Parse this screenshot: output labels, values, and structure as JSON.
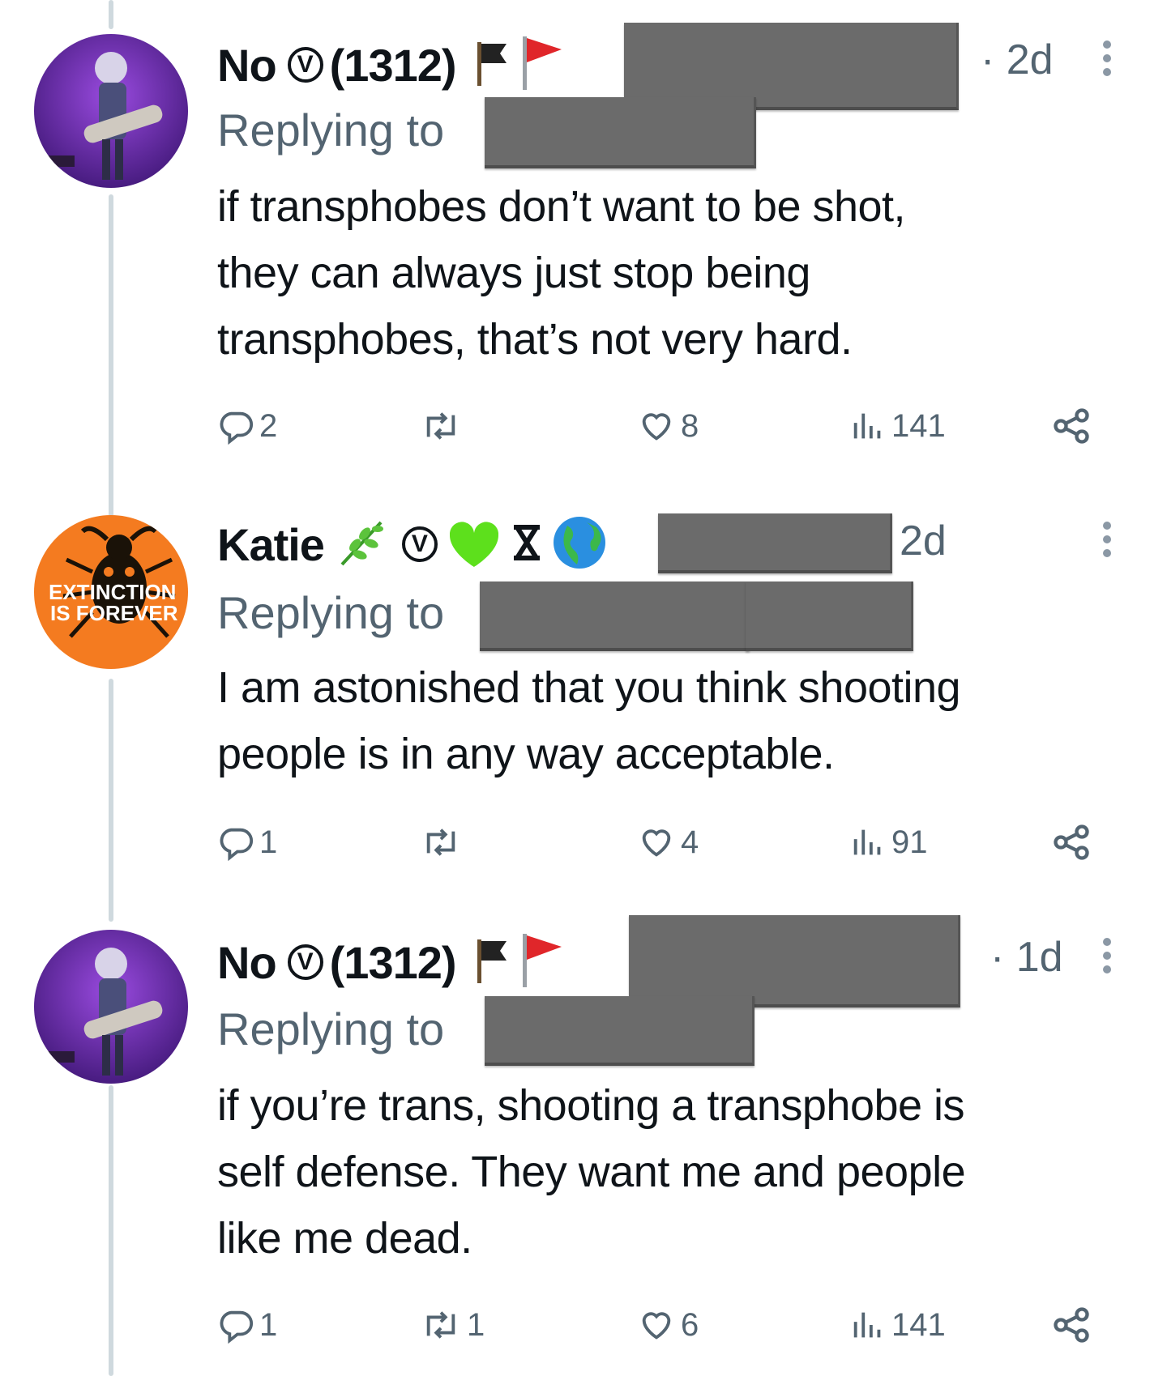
{
  "tweets": [
    {
      "author": "No",
      "verified_badge": "V",
      "handle_suffix": "(1312)",
      "flags": [
        "black-flag",
        "red-triangular-flag"
      ],
      "time": "· 2d",
      "reply_label": "Replying to",
      "text_lines": [
        "if transphobes don’t want to be shot,",
        "they can always just stop being",
        "transphobes, that’s not very hard."
      ],
      "stats": {
        "replies": "2",
        "reposts": "",
        "likes": "8",
        "views": "141"
      }
    },
    {
      "author": "Katie",
      "verified_badge": "V",
      "emoji_icons": [
        "herb-emoji",
        "green-heart-emoji",
        "hourglass-glyph",
        "globe-americas-emoji"
      ],
      "time": "2d",
      "reply_label": "Replying to",
      "avatar_text": [
        "EXTINCTION",
        "IS FOREVER"
      ],
      "text_lines": [
        "I am astonished that you think shooting",
        "people is in any way acceptable."
      ],
      "stats": {
        "replies": "1",
        "reposts": "",
        "likes": "4",
        "views": "91"
      }
    },
    {
      "author": "No",
      "verified_badge": "V",
      "handle_suffix": "(1312)",
      "flags": [
        "black-flag",
        "red-triangular-flag"
      ],
      "time": "· 1d",
      "reply_label": "Replying to",
      "text_lines": [
        "if you’re trans, shooting a transphobe is",
        "self defense. They want me and people",
        "like me dead."
      ],
      "stats": {
        "replies": "1",
        "reposts": "1",
        "likes": "6",
        "views": "141"
      }
    }
  ],
  "colors": {
    "text": "#0f1419",
    "secondary": "#536471",
    "thread_line": "#cfd9de",
    "redaction": "#6b6b6b",
    "katie_avatar": "#f47b20",
    "no_avatar": "#6a2aa8"
  }
}
